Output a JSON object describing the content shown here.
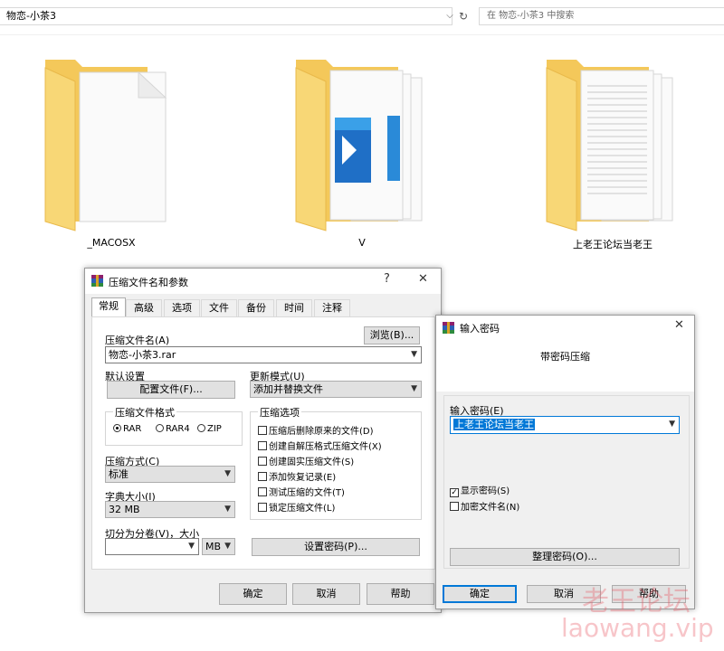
{
  "explorer": {
    "address": "物恋-小茶3",
    "search_placeholder": "在 物恋-小茶3 中搜索",
    "folders": [
      {
        "label": "_MACOSX"
      },
      {
        "label": "V"
      },
      {
        "label": "上老王论坛当老王"
      }
    ]
  },
  "archive_dialog": {
    "title": "压缩文件名和参数",
    "help_glyph": "?",
    "close_glyph": "✕",
    "tabs": [
      "常规",
      "高级",
      "选项",
      "文件",
      "备份",
      "时间",
      "注释"
    ],
    "archive_name_label": "压缩文件名(A)",
    "archive_name_value": "物恋-小茶3.rar",
    "browse_button": "浏览(B)...",
    "default_settings_label": "默认设置",
    "profiles_button": "配置文件(F)...",
    "update_mode_label": "更新模式(U)",
    "update_mode_value": "添加并替换文件",
    "format_group": "压缩文件格式",
    "formats": [
      "RAR",
      "RAR4",
      "ZIP"
    ],
    "selected_format": "RAR",
    "method_label": "压缩方式(C)",
    "method_value": "标准",
    "dict_label": "字典大小(I)",
    "dict_value": "32 MB",
    "split_label": "切分为分卷(V)，大小",
    "split_value": "",
    "split_unit": "MB",
    "options_group": "压缩选项",
    "options": [
      {
        "label": "压缩后删除原来的文件(D)",
        "checked": false
      },
      {
        "label": "创建自解压格式压缩文件(X)",
        "checked": false
      },
      {
        "label": "创建固实压缩文件(S)",
        "checked": false
      },
      {
        "label": "添加恢复记录(E)",
        "checked": false
      },
      {
        "label": "测试压缩的文件(T)",
        "checked": false
      },
      {
        "label": "锁定压缩文件(L)",
        "checked": false
      }
    ],
    "set_password_button": "设置密码(P)...",
    "ok_button": "确定",
    "cancel_button": "取消",
    "help_button": "帮助"
  },
  "password_dialog": {
    "title": "输入密码",
    "close_glyph": "✕",
    "heading": "带密码压缩",
    "password_label": "输入密码(E)",
    "password_value": "上老王论坛当老王",
    "show_password_label": "显示密码(S)",
    "show_password_checked": true,
    "encrypt_names_label": "加密文件名(N)",
    "encrypt_names_checked": false,
    "organize_button": "整理密码(O)...",
    "ok_button": "确定",
    "cancel_button": "取消",
    "help_button": "帮助"
  },
  "watermark": {
    "line1": "老王论坛",
    "line2": "laowang.vip"
  }
}
